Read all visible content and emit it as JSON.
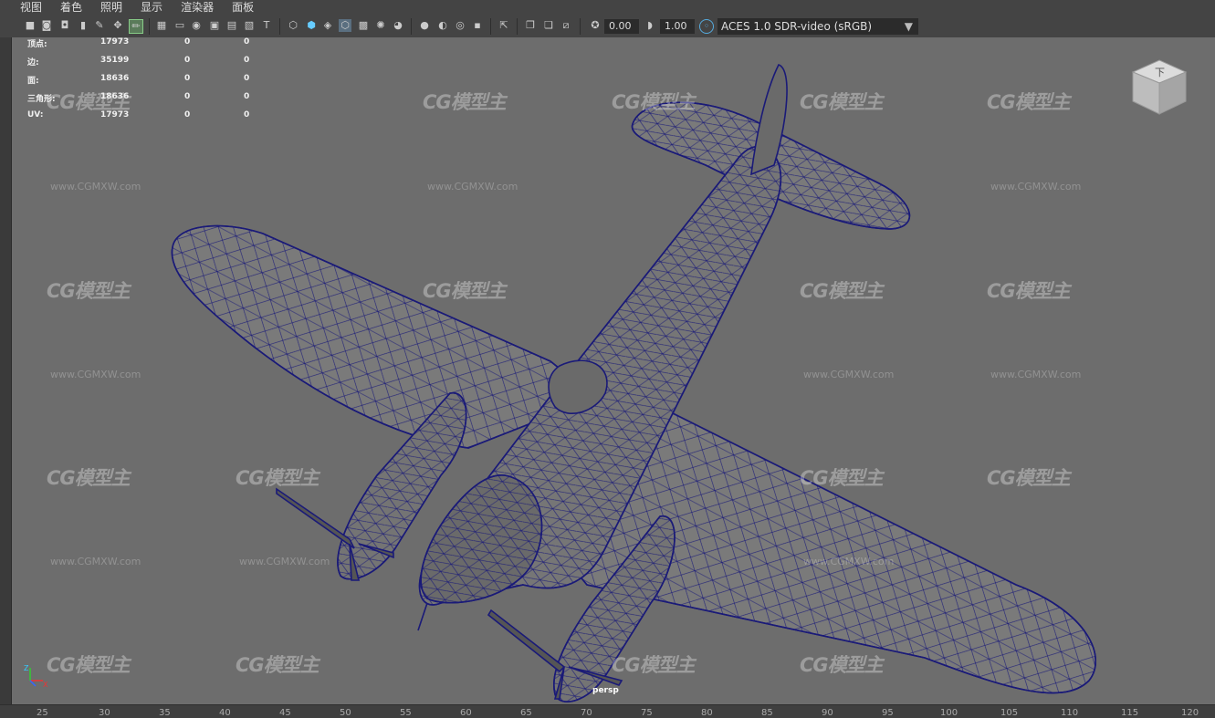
{
  "menu": [
    "视图",
    "着色",
    "照明",
    "显示",
    "渲染器",
    "面板"
  ],
  "toolbar": {
    "exposure_value": "0.00",
    "gamma_value": "1.00",
    "color_transform": "ACES 1.0 SDR-video (sRGB)",
    "icons": [
      "camera-icon",
      "camera-attrs-icon",
      "bookmark-icon",
      "image-plane-icon",
      "grid-icon",
      "film-gate-icon",
      "resolution-gate-icon",
      "gate-mask-icon",
      "field-chart-icon",
      "safe-action-icon",
      "safe-title-icon",
      "wireframe-icon",
      "smooth-shade-icon",
      "default-material-icon",
      "wireframe-on-shaded-icon",
      "xray-icon",
      "use-lights-icon",
      "shadows-icon",
      "ambient-occlusion-icon",
      "motion-blur-icon",
      "anti-aliasing-icon",
      "depth-of-field-icon",
      "isolate-select-icon",
      "xray-joints-icon",
      "xray-active-icon",
      "backface-culling-icon",
      "exposure-icon",
      "gamma-icon",
      "color-management-icon"
    ]
  },
  "hud": {
    "rows": [
      {
        "label": "顶点:",
        "total": "17973",
        "a": "0",
        "b": "0"
      },
      {
        "label": "边:",
        "total": "35199",
        "a": "0",
        "b": "0"
      },
      {
        "label": "面:",
        "total": "18636",
        "a": "0",
        "b": "0"
      },
      {
        "label": "三角形:",
        "total": "18636",
        "a": "0",
        "b": "0"
      },
      {
        "label": "UV:",
        "total": "17973",
        "a": "0",
        "b": "0"
      }
    ]
  },
  "viewport": {
    "camera_label": "persp",
    "viewcube_face": "下",
    "background_color": "#6d6d6d",
    "wireframe_color": "#1a1a78"
  },
  "watermark": {
    "logo": "CG模型主",
    "url": "www.CGMXW.com"
  },
  "ruler": {
    "ticks": [
      "25",
      "30",
      "35",
      "40",
      "45",
      "50",
      "55",
      "60",
      "65",
      "70",
      "75",
      "80",
      "85",
      "90",
      "95",
      "100",
      "105",
      "110",
      "115",
      "120"
    ]
  },
  "axis": {
    "x": "X",
    "y": "Y",
    "z": "Z"
  }
}
